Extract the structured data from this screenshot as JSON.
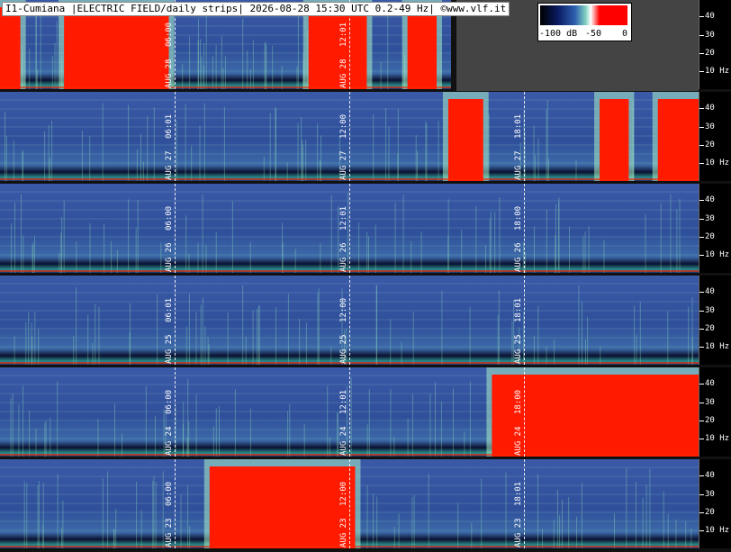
{
  "chart_data": {
    "type": "heatmap",
    "title": "I1-Cumiana |ELECTRIC FIELD/daily strips| 2026-08-28 15:30 UTC 0.2-49 Hz| ©www.vlf.it",
    "colorbar": {
      "labels": [
        "-100 dB",
        "-50",
        "0"
      ],
      "range_db": [
        -100,
        0
      ]
    },
    "y_axis": {
      "range_hz": [
        0.2,
        49
      ],
      "ticks": [
        "40",
        "30",
        "20",
        "10 Hz"
      ],
      "tick_values": [
        40,
        30,
        20,
        10
      ]
    },
    "strips": [
      {
        "date": "AUG 28",
        "markers": [
          {
            "time": "06:00",
            "hour": 6
          },
          {
            "time": "12:01",
            "hour": 12
          }
        ],
        "data_until_hour": 15.5,
        "red_segments": [
          [
            0,
            0.7
          ],
          [
            2.2,
            5.8
          ],
          [
            10.6,
            12.6
          ],
          [
            14.0,
            15.0
          ]
        ]
      },
      {
        "date": "AUG 27",
        "markers": [
          {
            "time": "06:01",
            "hour": 6
          },
          {
            "time": "12:00",
            "hour": 12
          },
          {
            "time": "18:01",
            "hour": 18
          }
        ],
        "red_segments": [
          [
            15.4,
            16.6
          ],
          [
            20.6,
            21.6
          ],
          [
            22.6,
            24
          ]
        ]
      },
      {
        "date": "AUG 26",
        "markers": [
          {
            "time": "06:00",
            "hour": 6
          },
          {
            "time": "12:01",
            "hour": 12
          },
          {
            "time": "18:00",
            "hour": 18
          }
        ],
        "red_segments": []
      },
      {
        "date": "AUG 25",
        "markers": [
          {
            "time": "06:01",
            "hour": 6
          },
          {
            "time": "12:00",
            "hour": 12
          },
          {
            "time": "18:01",
            "hour": 18
          }
        ],
        "red_segments": []
      },
      {
        "date": "AUG 24",
        "markers": [
          {
            "time": "06:00",
            "hour": 6
          },
          {
            "time": "12:01",
            "hour": 12
          },
          {
            "time": "18:00",
            "hour": 18
          }
        ],
        "red_segments": [
          [
            16.9,
            24
          ]
        ]
      },
      {
        "date": "AUG 23",
        "markers": [
          {
            "time": "06:00",
            "hour": 6
          },
          {
            "time": "12:00",
            "hour": 12
          },
          {
            "time": "18:01",
            "hour": 18
          }
        ],
        "red_segments": [
          [
            7.2,
            12.2
          ]
        ]
      }
    ]
  }
}
